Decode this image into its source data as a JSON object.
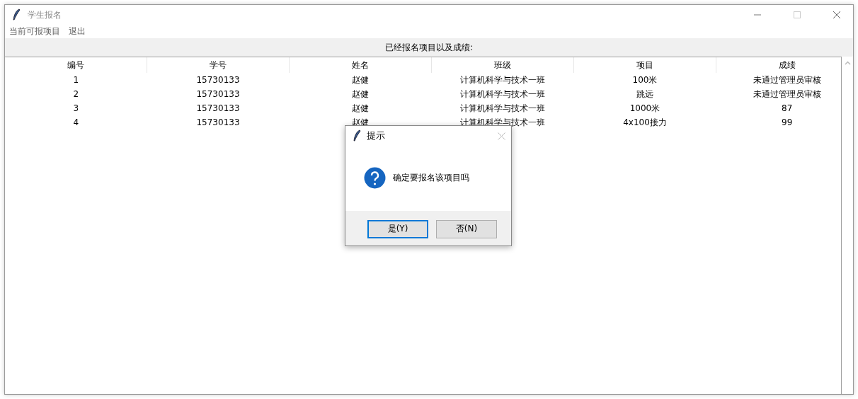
{
  "window": {
    "title": "学生报名"
  },
  "menu": [
    "当前可报项目",
    "退出"
  ],
  "section_title": "已经报名项目以及成绩:",
  "table": {
    "columns": [
      "编号",
      "学号",
      "姓名",
      "班级",
      "项目",
      "成绩"
    ],
    "rows": [
      [
        "1",
        "15730133",
        "赵健",
        "计算机科学与技术一班",
        "100米",
        "未通过管理员审核"
      ],
      [
        "2",
        "15730133",
        "赵健",
        "计算机科学与技术一班",
        "跳远",
        "未通过管理员审核"
      ],
      [
        "3",
        "15730133",
        "赵健",
        "计算机科学与技术一班",
        "1000米",
        "87"
      ],
      [
        "4",
        "15730133",
        "赵健",
        "计算机科学与技术一班",
        "4x100接力",
        "99"
      ]
    ]
  },
  "dialog": {
    "title": "提示",
    "message": "确定要报名该项目吗",
    "buttons": [
      {
        "label": "是(Y)",
        "selected": true
      },
      {
        "label": "否(N)",
        "selected": false
      }
    ]
  }
}
